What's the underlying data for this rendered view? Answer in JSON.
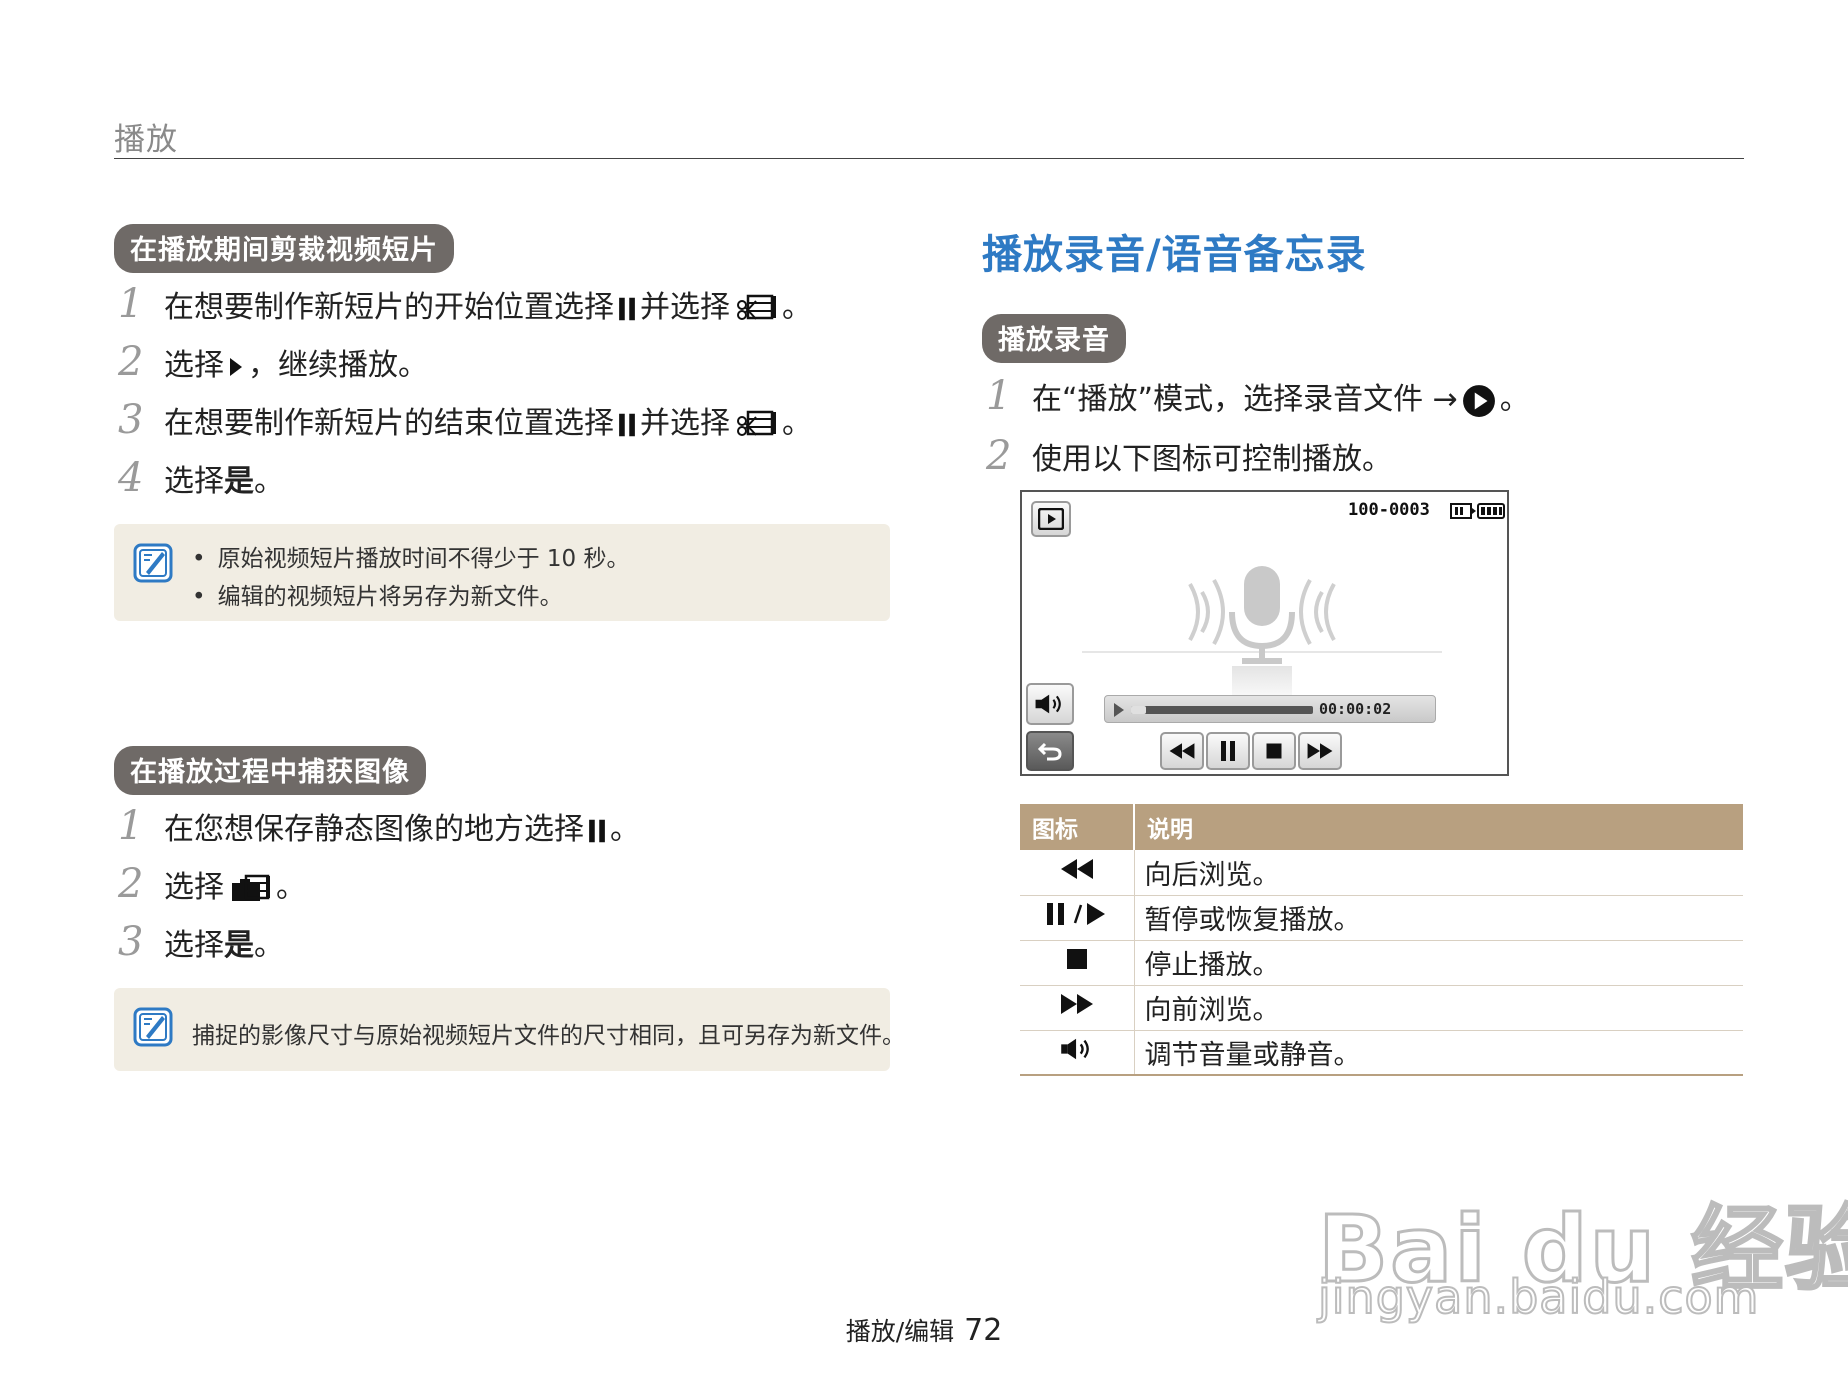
{
  "header": {
    "section": "播放"
  },
  "left": {
    "trim": {
      "heading": "在播放期间剪裁视频短片",
      "steps": [
        {
          "num": "1",
          "a": "在想要制作新短片的开始位置选择",
          "b": "并选择",
          "end": "。"
        },
        {
          "num": "2",
          "a": "选择",
          "b": "，继续播放。"
        },
        {
          "num": "3",
          "a": "在想要制作新短片的结束位置选择",
          "b": "并选择",
          "end": "。"
        },
        {
          "num": "4",
          "a": "选择",
          "bold": "是",
          "end": "。"
        }
      ],
      "notes": [
        "原始视频短片播放时间不得少于 10 秒。",
        "编辑的视频短片将另存为新文件。"
      ]
    },
    "capture": {
      "heading": "在播放过程中捕获图像",
      "steps": [
        {
          "num": "1",
          "a": "在您想保存静态图像的地方选择",
          "end": "。"
        },
        {
          "num": "2",
          "a": "选择",
          "end": "。"
        },
        {
          "num": "3",
          "a": "选择",
          "bold": "是",
          "end": "。"
        }
      ],
      "note": "捕捉的影像尺寸与原始视频短片文件的尺寸相同，且可另存为新文件。"
    }
  },
  "right": {
    "title": "播放录音/语音备忘录",
    "subheading": "播放录音",
    "steps": [
      {
        "num": "1",
        "a": "在“播放”模式，选择录音文件 →",
        "end": "。"
      },
      {
        "num": "2",
        "a": "使用以下图标可控制播放。"
      }
    ],
    "screen": {
      "file_number": "100-0003",
      "time": "00:00:02",
      "progress": 0.08
    },
    "table": {
      "headers": [
        "图标",
        "说明"
      ],
      "rows": [
        {
          "icon": "rewind-icon",
          "desc": "向后浏览。"
        },
        {
          "icon": "pause-play-icon",
          "desc": "暂停或恢复播放。"
        },
        {
          "icon": "stop-icon",
          "desc": "停止播放。"
        },
        {
          "icon": "fast-forward-icon",
          "desc": "向前浏览。"
        },
        {
          "icon": "volume-icon",
          "desc": "调节音量或静音。"
        }
      ]
    }
  },
  "footer": {
    "label": "播放/编辑",
    "page": "72"
  },
  "watermark": {
    "brand": "Bai du 经验",
    "url": "jingyan.baidu.com"
  },
  "colors": {
    "title_blue": "#2e7ac4",
    "pill_gray": "#6f6a67",
    "note_bg": "#f1ede3",
    "table_header": "#b8a080"
  }
}
